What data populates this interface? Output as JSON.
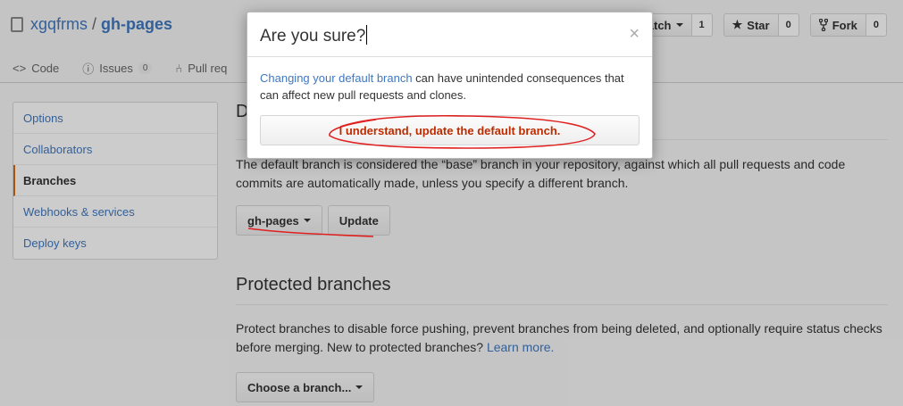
{
  "repo": {
    "owner": "xgqfrms",
    "separator": "/",
    "name": "gh-pages"
  },
  "actions": [
    {
      "label": "atch",
      "count": "1"
    },
    {
      "label": "Star",
      "count": "0"
    },
    {
      "label": "Fork",
      "count": "0"
    }
  ],
  "reponav": {
    "code": "Code",
    "issues": "Issues",
    "issues_count": "0",
    "pull_requests": "Pull req"
  },
  "menu": [
    "Options",
    "Collaborators",
    "Branches",
    "Webhooks & services",
    "Deploy keys"
  ],
  "default_branch": {
    "title": "D",
    "description": "The default branch is considered the “base” branch in your repository, against which all pull requests and code commits are automatically made, unless you specify a different branch.",
    "branch": "gh-pages",
    "update_label": "Update"
  },
  "protected": {
    "title": "Protected branches",
    "description": "Protect branches to disable force pushing, prevent branches from being deleted, and optionally require status checks before merging. New to protected branches?",
    "learn_more": "Learn more.",
    "choose_label": "Choose a branch..."
  },
  "dialog": {
    "title": "Are you sure?",
    "close": "×",
    "link_text": "Changing your default branch",
    "text": " can have unintended consequences that can affect new pull requests and clones.",
    "confirm_label": "I understand, update the default branch."
  },
  "colors": {
    "link": "#4078c0",
    "danger": "#bd2c00",
    "selected_accent": "#d26911",
    "annotation": "#e0201f"
  }
}
